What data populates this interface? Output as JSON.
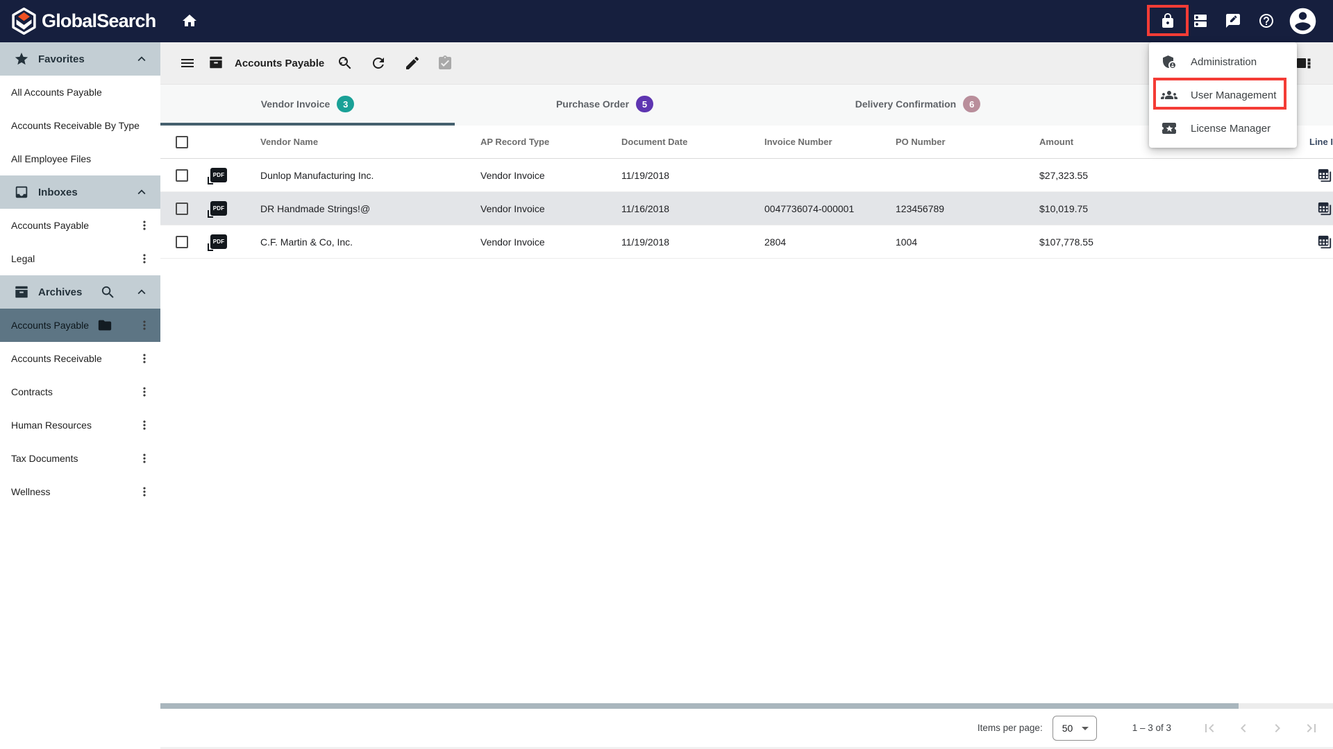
{
  "navbar": {
    "brand": "GlobalSearch"
  },
  "user_menu": {
    "items": [
      {
        "label": "Administration",
        "icon": "admin"
      },
      {
        "label": "User Management",
        "icon": "groups",
        "highlighted": true
      },
      {
        "label": "License Manager",
        "icon": "ticket"
      }
    ]
  },
  "sidebar": {
    "sections": [
      {
        "label": "Favorites",
        "icon": "star",
        "items": [
          {
            "label": "All Accounts Payable"
          },
          {
            "label": "Accounts Receivable By Type"
          },
          {
            "label": "All Employee Files"
          }
        ]
      },
      {
        "label": "Inboxes",
        "icon": "inbox",
        "items": [
          {
            "label": "Accounts Payable",
            "kebab": true
          },
          {
            "label": "Legal",
            "kebab": true
          }
        ]
      },
      {
        "label": "Archives",
        "icon": "archive",
        "search": true,
        "items": [
          {
            "label": "Accounts Payable",
            "selected": true,
            "folder": true,
            "kebab": true
          },
          {
            "label": "Accounts Receivable",
            "kebab": true
          },
          {
            "label": "Contracts",
            "kebab": true
          },
          {
            "label": "Human Resources",
            "kebab": true
          },
          {
            "label": "Tax Documents",
            "kebab": true
          },
          {
            "label": "Wellness",
            "kebab": true
          }
        ]
      }
    ]
  },
  "toolbar": {
    "title": "Accounts Payable"
  },
  "tabs": [
    {
      "label": "Vendor Invoice",
      "count": "3",
      "badge_color": "#1aa197",
      "active": true
    },
    {
      "label": "Purchase Order",
      "count": "5",
      "badge_color": "#5e35b1",
      "active": false
    },
    {
      "label": "Delivery Confirmation",
      "count": "6",
      "badge_color": "#b98e9b",
      "active": false
    }
  ],
  "table": {
    "columns": [
      "Vendor Name",
      "AP Record Type",
      "Document Date",
      "Invoice Number",
      "PO Number",
      "Amount",
      "Line Items"
    ],
    "rows": [
      {
        "vendor": "Dunlop Manufacturing Inc.",
        "type": "Vendor Invoice",
        "date": "11/19/2018",
        "invoice": "",
        "po": "",
        "amount": "$27,323.55",
        "selected": false
      },
      {
        "vendor": "DR Handmade Strings!@",
        "type": "Vendor Invoice",
        "date": "11/16/2018",
        "invoice": "0047736074-000001",
        "po": "123456789",
        "amount": "$10,019.75",
        "selected": true
      },
      {
        "vendor": "C.F. Martin & Co, Inc.",
        "type": "Vendor Invoice",
        "date": "11/19/2018",
        "invoice": "2804",
        "po": "1004",
        "amount": "$107,778.55",
        "selected": false
      }
    ]
  },
  "pagination": {
    "items_per_page_label": "Items per page:",
    "page_size": "50",
    "range_label": "1 – 3 of 3"
  },
  "colors": {
    "navbar_bg": "#161f3e",
    "section_header_bg": "#c3ced4",
    "selected_item_bg": "#5d7584",
    "selected_row_bg": "#e3e5e8",
    "active_tab_underline": "#45606e",
    "highlight_red": "#f43c36"
  }
}
